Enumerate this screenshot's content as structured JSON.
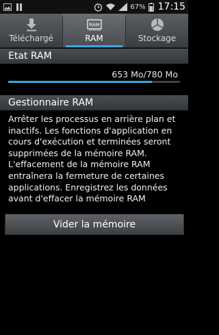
{
  "status_bar": {
    "battery_percent": "67%",
    "time": "17:15",
    "icons": [
      "image-icon",
      "pause-icon",
      "alarm-icon",
      "wifi-icon",
      "signal-icon",
      "battery-icon"
    ]
  },
  "tabs": [
    {
      "label": "Téléchargé",
      "icon": "download-arrow-icon",
      "active": false
    },
    {
      "label": "RAM",
      "icon": "ram-chip-icon",
      "active": true
    },
    {
      "label": "Stockage",
      "icon": "pie-chart-icon",
      "active": false
    }
  ],
  "ram_icon_text": "RAM",
  "ram_state": {
    "title": "Etat RAM",
    "usage_text": "653 Mo/780 Mo",
    "used_mb": 653,
    "total_mb": 780
  },
  "ram_manager": {
    "title": "Gestionnaire RAM",
    "description": "Arrêter les processus en arrière plan et inactifs. Les fonctions d'application en cours d'exécution et terminées seront supprimées de la mémoire RAM. L'effacement de la mémoire RAM entraînera la fermeture de certaines applications. Enregistrez les données avant d'effacer la mémoire RAM",
    "button_label": "Vider la mémoire"
  },
  "colors": {
    "accent": "#3aa7e0",
    "background": "#000000"
  }
}
